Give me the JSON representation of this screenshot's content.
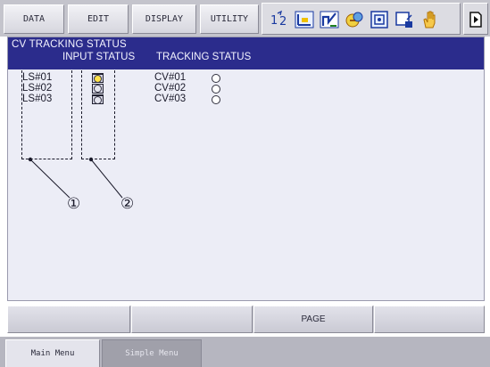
{
  "top_menu": {
    "items": [
      {
        "label": "DATA"
      },
      {
        "label": "EDIT"
      },
      {
        "label": "DISPLAY"
      },
      {
        "label": "UTILITY"
      }
    ],
    "toolbar_icons": [
      "coordinate-toggle-icon",
      "axis-frame-icon",
      "tool-icon",
      "job-icon",
      "user-frame-icon",
      "display-window-icon",
      "hand-icon"
    ],
    "last_icon": "page-marker-icon"
  },
  "screen": {
    "title": "CV TRACKING STATUS",
    "input_status_header": "INPUT STATUS",
    "tracking_status_header": "TRACKING STATUS",
    "input_rows": [
      {
        "label": "LS#01",
        "status": "on"
      },
      {
        "label": "LS#02",
        "status": "off"
      },
      {
        "label": "LS#03",
        "status": "off"
      }
    ],
    "tracking_rows": [
      {
        "label": "CV#01",
        "status": "off"
      },
      {
        "label": "CV#02",
        "status": "off"
      },
      {
        "label": "CV#03",
        "status": "off"
      }
    ],
    "annotations": [
      "①",
      "②"
    ]
  },
  "function_keys": {
    "keys": [
      "",
      "",
      "PAGE",
      ""
    ]
  },
  "bottom_menu": {
    "main_menu": "Main Menu",
    "simple_menu": "Simple Menu"
  },
  "colors": {
    "title_bar": "#2b2c8c",
    "panel_bg": "#ecedf6",
    "lamp_on": "#ffe24a"
  }
}
